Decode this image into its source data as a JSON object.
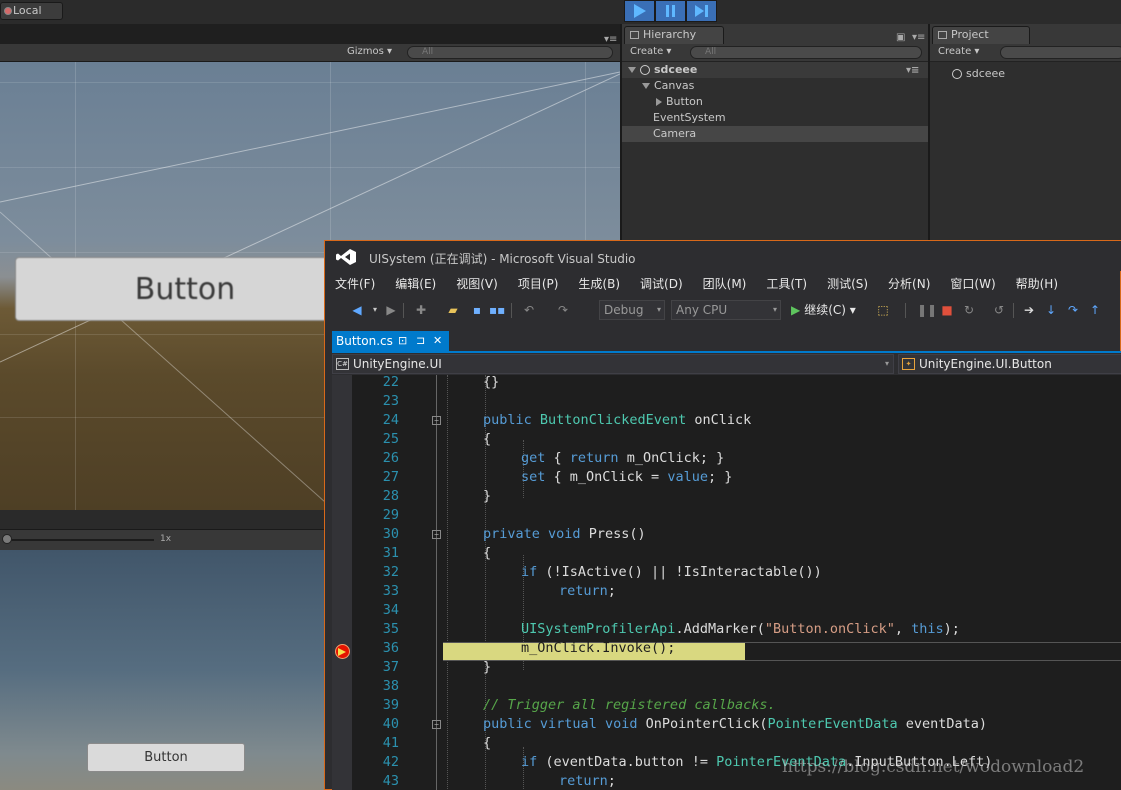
{
  "unity": {
    "pivot_mode": "Local",
    "scene_view": {
      "gizmos_label": "Gizmos",
      "search_placeholder": "All",
      "button_text": "Button"
    },
    "game_view": {
      "zoom_label": "1x",
      "button_text": "Button"
    },
    "hierarchy": {
      "tab_label": "Hierarchy",
      "create_label": "Create",
      "search_placeholder": "All",
      "items": [
        {
          "label": "sdceee",
          "depth": 0
        },
        {
          "label": "Canvas",
          "depth": 1
        },
        {
          "label": "Button",
          "depth": 2
        },
        {
          "label": "EventSystem",
          "depth": 1
        },
        {
          "label": "Camera",
          "depth": 1
        }
      ]
    },
    "project": {
      "tab_label": "Project",
      "create_label": "Create",
      "items": [
        {
          "label": "sdceee"
        }
      ]
    }
  },
  "vs": {
    "title": "UISystem (正在调试) - Microsoft Visual Studio",
    "menu": [
      "文件(F)",
      "编辑(E)",
      "视图(V)",
      "项目(P)",
      "生成(B)",
      "调试(D)",
      "团队(M)",
      "工具(T)",
      "测试(S)",
      "分析(N)",
      "窗口(W)",
      "帮助(H)"
    ],
    "toolbar": {
      "config": "Debug",
      "platform": "Any CPU",
      "continue_label": "继续(C)"
    },
    "tab": {
      "filename": "Button.cs",
      "pin_glyph": "⊐",
      "close_glyph": "✕"
    },
    "nav": {
      "namespace": "UnityEngine.UI",
      "class": "UnityEngine.UI.Button"
    },
    "code_lines": [
      {
        "n": "22",
        "text": "{}"
      },
      {
        "n": "23",
        "text": ""
      },
      {
        "n": "24",
        "text": "public ButtonClickedEvent onClick"
      },
      {
        "n": "25",
        "text": "{"
      },
      {
        "n": "26",
        "text": "get { return m_OnClick; }"
      },
      {
        "n": "27",
        "text": "set { m_OnClick = value; }"
      },
      {
        "n": "28",
        "text": "}"
      },
      {
        "n": "29",
        "text": ""
      },
      {
        "n": "30",
        "text": "private void Press()"
      },
      {
        "n": "31",
        "text": "{"
      },
      {
        "n": "32",
        "text": "if (!IsActive() || !IsInteractable())"
      },
      {
        "n": "33",
        "text": "return;"
      },
      {
        "n": "34",
        "text": ""
      },
      {
        "n": "35",
        "text": "UISystemProfilerApi.AddMarker(\"Button.onClick\", this);"
      },
      {
        "n": "36",
        "text": "m_OnClick.Invoke();"
      },
      {
        "n": "37",
        "text": "}"
      },
      {
        "n": "38",
        "text": ""
      },
      {
        "n": "39",
        "text": "// Trigger all registered callbacks."
      },
      {
        "n": "40",
        "text": "public virtual void OnPointerClick(PointerEventData eventData)"
      },
      {
        "n": "41",
        "text": "{"
      },
      {
        "n": "42",
        "text": "if (eventData.button != PointerEventData.InputButton.Left)"
      },
      {
        "n": "43",
        "text": "return;"
      }
    ],
    "current_line": "36",
    "watermark": "https://blog.csdn.net/wodownload2"
  },
  "colors": {
    "vs_accent": "#007acc",
    "vs_border": "#d8691a",
    "current_line": "#d9d880",
    "keyword": "#569cd6",
    "type": "#4ec9b0",
    "string": "#d69d85",
    "comment": "#57a64a"
  }
}
